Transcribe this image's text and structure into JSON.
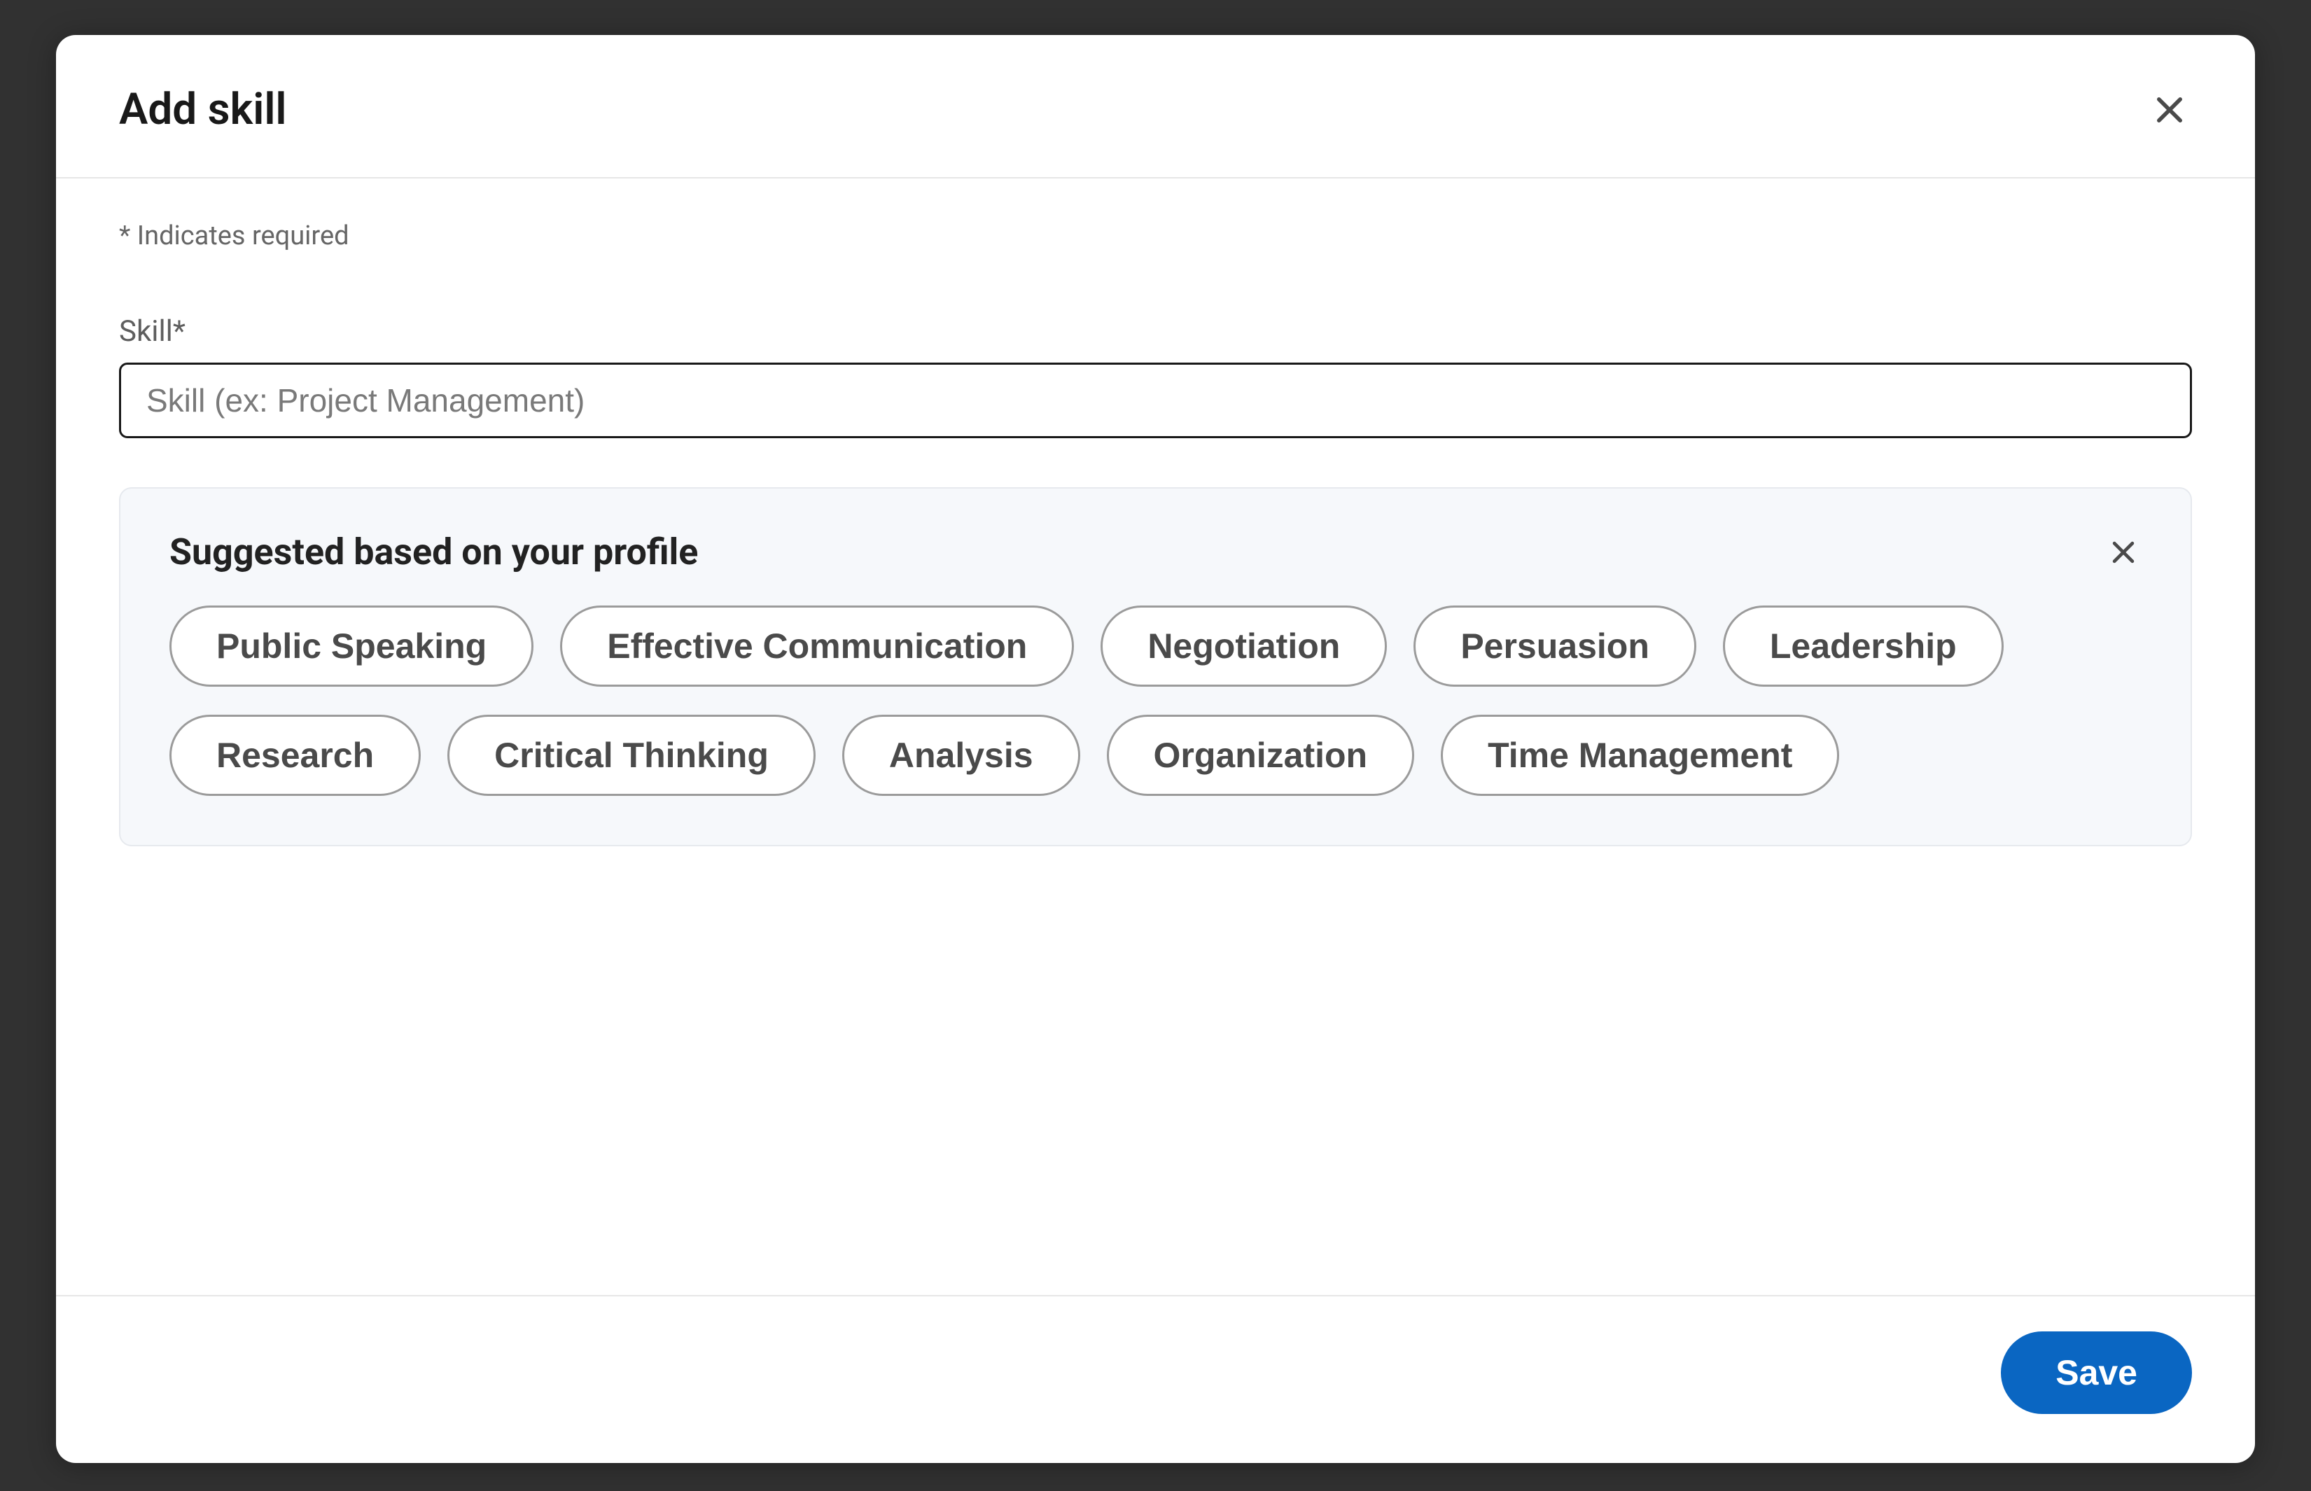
{
  "modal": {
    "title": "Add skill",
    "required_note": "* Indicates required",
    "field_label": "Skill*",
    "skill_placeholder": "Skill (ex: Project Management)",
    "skill_value": ""
  },
  "suggestions": {
    "title": "Suggested based on your profile",
    "items": [
      "Public Speaking",
      "Effective Communication",
      "Negotiation",
      "Persuasion",
      "Leadership",
      "Research",
      "Critical Thinking",
      "Analysis",
      "Organization",
      "Time Management"
    ]
  },
  "footer": {
    "save_label": "Save"
  },
  "icons": {
    "close": "close-icon",
    "dismiss": "close-icon"
  }
}
